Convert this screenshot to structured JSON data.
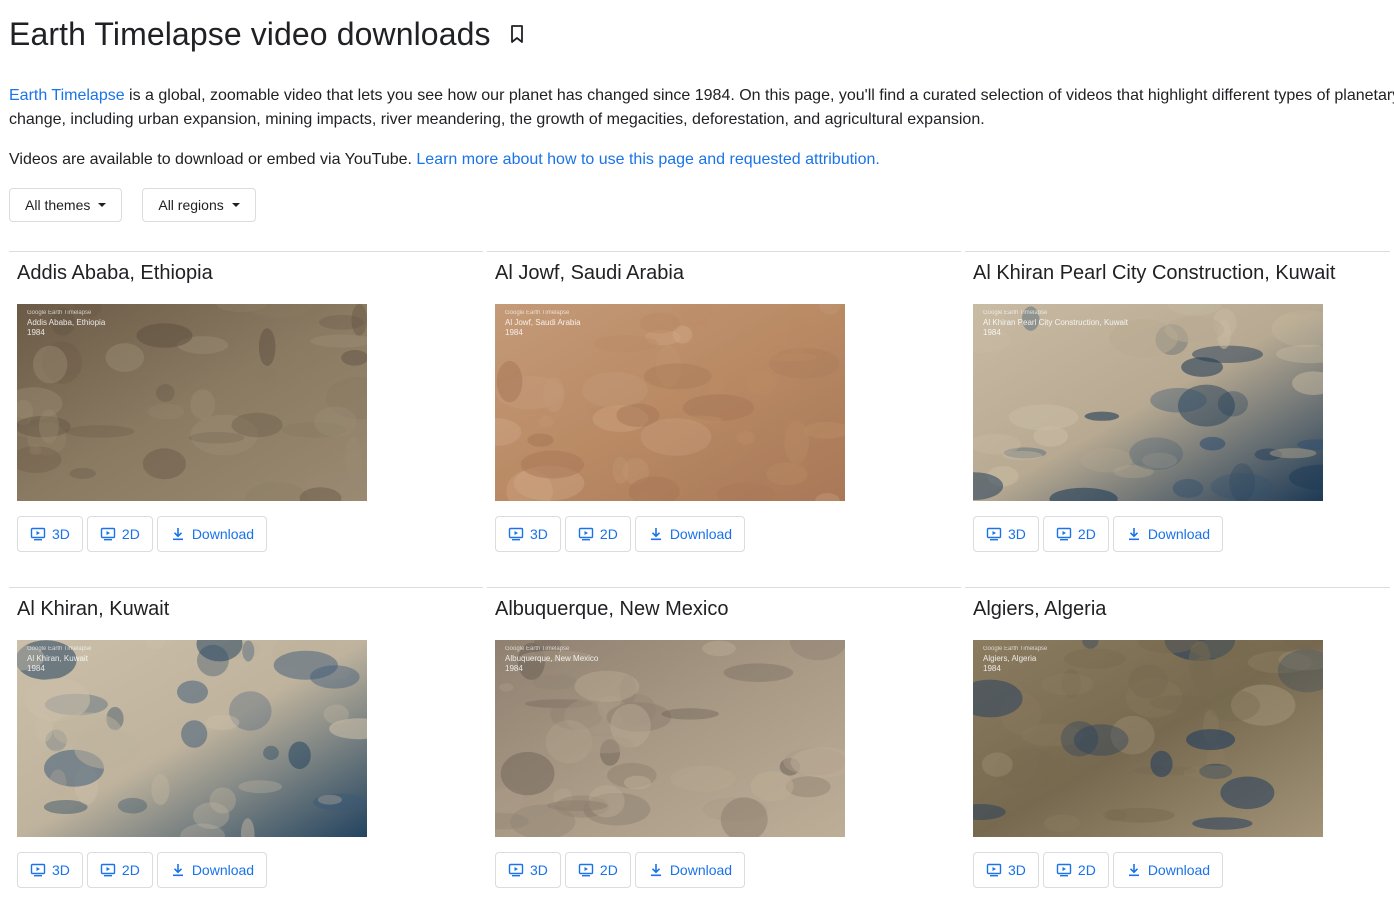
{
  "page": {
    "title": "Earth Timelapse video downloads",
    "intro_link": "Earth Timelapse",
    "intro_text": " is a global, zoomable video that lets you see how our planet has changed since 1984. On this page, you'll find a curated selection of videos that highlight different types of planetary change, including urban expansion, mining impacts, river meandering, the growth of megacities, deforestation, and agricultural expansion.",
    "attribution_text": "Videos are available to download or embed via YouTube. ",
    "attribution_link": "Learn more about how to use this page and requested attribution."
  },
  "filters": {
    "themes_label": "All themes",
    "regions_label": "All regions"
  },
  "buttons": {
    "three_d": "3D",
    "two_d": "2D",
    "download": "Download"
  },
  "thumb_brand": "Google Earth Timelapse",
  "cards": [
    {
      "title": "Addis Ababa, Ethiopia",
      "caption": "Addis Ababa, Ethiopia",
      "year": "1984",
      "colors": [
        "#6b5a46",
        "#8a7a62",
        "#5e5042",
        "#9a8a72"
      ]
    },
    {
      "title": "Al Jowf, Saudi Arabia",
      "caption": "Al Jowf, Saudi Arabia",
      "year": "1984",
      "colors": [
        "#c49a78",
        "#b98a64",
        "#d3ab8a",
        "#a87858"
      ]
    },
    {
      "title": "Al Khiran Pearl City Construction, Kuwait",
      "caption": "Al Khiran Pearl City Construction, Kuwait",
      "year": "1984",
      "colors": [
        "#c9bba3",
        "#b8aa92",
        "#2f4f6e",
        "#1e3a56"
      ]
    },
    {
      "title": "Al Khiran, Kuwait",
      "caption": "Al Khiran, Kuwait",
      "year": "1984",
      "colors": [
        "#cbbfa9",
        "#bfb39d",
        "#3a5878",
        "#234460"
      ]
    },
    {
      "title": "Albuquerque, New Mexico",
      "caption": "Albuquerque, New Mexico",
      "year": "1984",
      "colors": [
        "#8f8070",
        "#a99a86",
        "#6f6458",
        "#bdae98"
      ]
    },
    {
      "title": "Algiers, Algeria",
      "caption": "Algiers, Algeria",
      "year": "1984",
      "colors": [
        "#8b7c60",
        "#76694f",
        "#1e3a5e",
        "#a39478"
      ]
    }
  ]
}
